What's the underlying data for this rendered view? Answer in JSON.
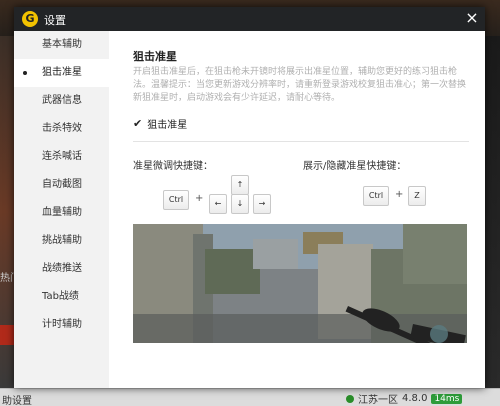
{
  "dialog": {
    "title": "设置",
    "logo": "G",
    "close_icon": "×"
  },
  "sidebar": {
    "items": [
      {
        "label": "基本辅助"
      },
      {
        "label": "狙击准星"
      },
      {
        "label": "武器信息"
      },
      {
        "label": "击杀特效"
      },
      {
        "label": "连杀喊话"
      },
      {
        "label": "自动截图"
      },
      {
        "label": "血量辅助"
      },
      {
        "label": "挑战辅助"
      },
      {
        "label": "战绩推送"
      },
      {
        "label": "Tab战绩"
      },
      {
        "label": "计时辅助"
      }
    ],
    "active_index": 1
  },
  "main": {
    "title": "狙击准星",
    "description": "开启狙击准星后，在狙击枪未开镜时将展示出准星位置，辅助您更好的练习狙击枪法。温馨提示：当您更新游戏分辨率时，请重新登录游戏校复狙击准心；第一次替换新狙准星时，启动游戏会有少许延迟，请耐心等待。",
    "checkbox": {
      "label": "狙击准星",
      "checked": true
    },
    "hotkey_adjust": {
      "label": "准星微调快捷键：",
      "keys": {
        "ctrl": "Ctrl",
        "up": "↑",
        "left": "←",
        "down": "↓",
        "right": "→"
      },
      "plus": "+"
    },
    "hotkey_toggle": {
      "label": "展示/隐藏准星快捷键：",
      "keys": {
        "ctrl": "Ctrl",
        "z": "Z"
      },
      "plus": "+"
    }
  },
  "background": {
    "left_text": "热门",
    "status_left": "助设置",
    "server": "江苏一区",
    "version": "4.8.0",
    "ping": "14ms"
  },
  "colors": {
    "titlebar": "#222426",
    "sidebar": "#f2f2f2",
    "logo": "#f2c200",
    "ping": "#2e9c3a"
  }
}
